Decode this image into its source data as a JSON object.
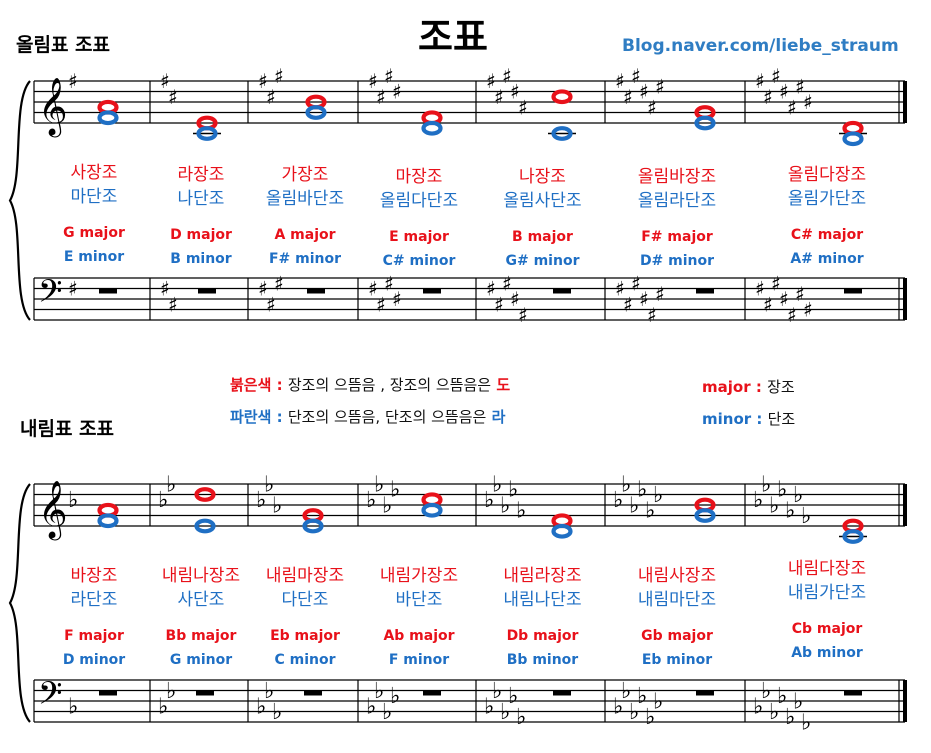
{
  "title": "조표",
  "blog": "Blog.naver.com/liebe_straum",
  "sharp_section": {
    "title": "올림표 조표",
    "keys": [
      {
        "major_kr": "사장조",
        "minor_kr": "마단조",
        "major_en": "G major",
        "minor_en": "E minor",
        "count": 1
      },
      {
        "major_kr": "라장조",
        "minor_kr": "나단조",
        "major_en": "D major",
        "minor_en": "B minor",
        "count": 2
      },
      {
        "major_kr": "가장조",
        "minor_kr": "올림바단조",
        "major_en": "A major",
        "minor_en": "F# minor",
        "count": 3
      },
      {
        "major_kr": "마장조",
        "minor_kr": "올림다단조",
        "major_en": "E major",
        "minor_en": "C# minor",
        "count": 4
      },
      {
        "major_kr": "나장조",
        "minor_kr": "올림사단조",
        "major_en": "B major",
        "minor_en": "G# minor",
        "count": 5
      },
      {
        "major_kr": "올림바장조",
        "minor_kr": "올림라단조",
        "major_en": "F# major",
        "minor_en": "D# minor",
        "count": 6
      },
      {
        "major_kr": "올림다장조",
        "minor_kr": "올림가단조",
        "major_en": "C# major",
        "minor_en": "A# minor",
        "count": 7
      }
    ]
  },
  "flat_section": {
    "title": "내림표 조표",
    "keys": [
      {
        "major_kr": "바장조",
        "minor_kr": "라단조",
        "major_en": "F major",
        "minor_en": "D minor",
        "count": 1
      },
      {
        "major_kr": "내림나장조",
        "minor_kr": "사단조",
        "major_en": "Bb major",
        "minor_en": "G minor",
        "count": 2
      },
      {
        "major_kr": "내림마장조",
        "minor_kr": "다단조",
        "major_en": "Eb major",
        "minor_en": "C minor",
        "count": 3
      },
      {
        "major_kr": "내림가장조",
        "minor_kr": "바단조",
        "major_en": "Ab major",
        "minor_en": "F minor",
        "count": 4
      },
      {
        "major_kr": "내림라장조",
        "minor_kr": "내림나단조",
        "major_en": "Db major",
        "minor_en": "Bb minor",
        "count": 5
      },
      {
        "major_kr": "내림사장조",
        "minor_kr": "내림마단조",
        "major_en": "Gb major",
        "minor_en": "Eb minor",
        "count": 6
      },
      {
        "major_kr": "내림다장조",
        "minor_kr": "내림가단조",
        "major_en": "Cb major",
        "minor_en": "Ab minor",
        "count": 7
      }
    ]
  },
  "legend": {
    "red_label": "붉은색 :",
    "red_text": "장조의 으뜸음 , 장조의 으뜸음은",
    "red_note": "도",
    "blue_label": "파란색 :",
    "blue_text": "단조의 으뜸음, 단조의 으뜸음은",
    "blue_note": "라",
    "major_label": "major :",
    "major_text": "장조",
    "minor_label": "minor :",
    "minor_text": "단조"
  },
  "colors": {
    "major": "#e8111a",
    "minor": "#1f6fc4",
    "link": "#2f7dc3"
  },
  "symbols": {
    "treble_clef": "𝄞",
    "bass_clef": "𝄢",
    "sharp": "♯",
    "flat": "♭",
    "whole_note": "𝅝"
  }
}
